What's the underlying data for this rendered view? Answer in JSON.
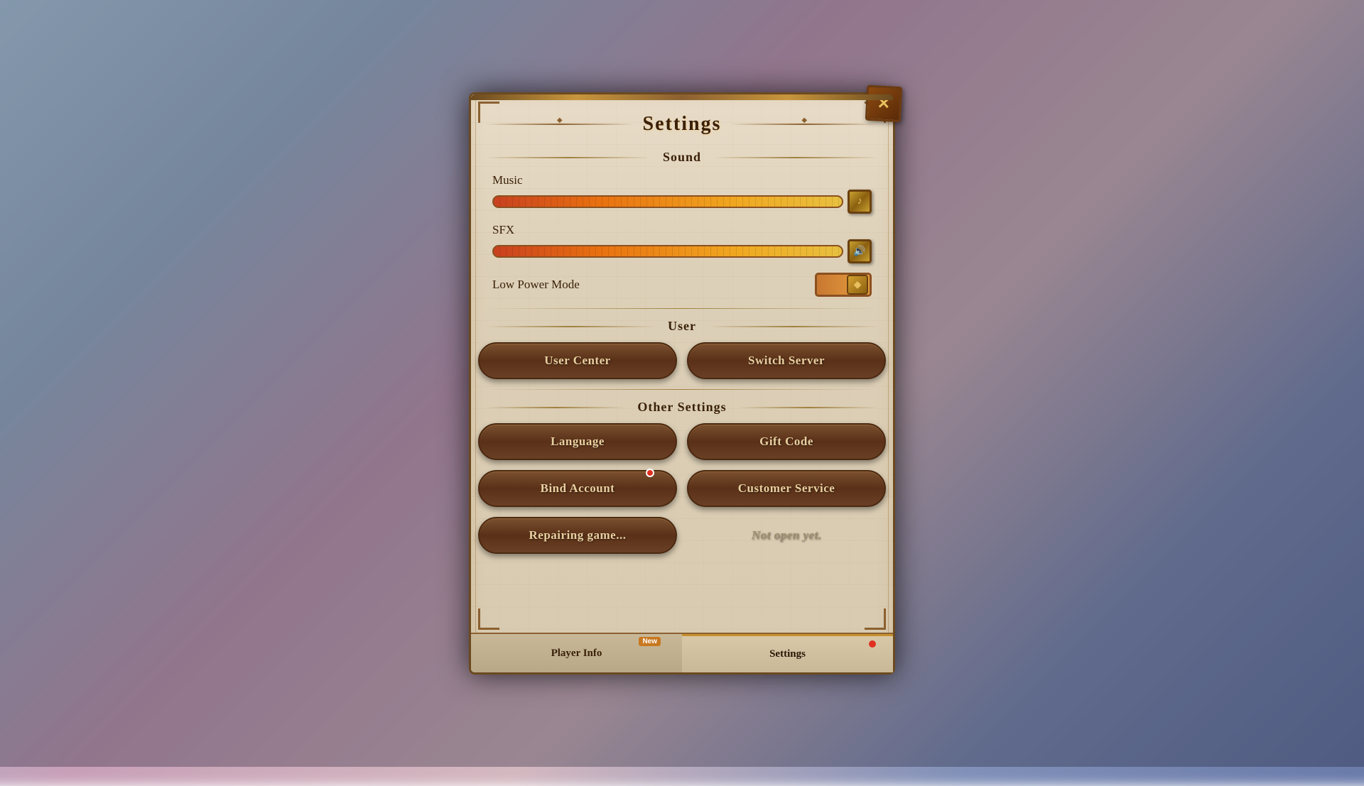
{
  "dialog": {
    "title": "Settings",
    "close_label": "✕"
  },
  "sound_section": {
    "label": "Sound",
    "music": {
      "label": "Music",
      "value": 95,
      "icon": "♪"
    },
    "sfx": {
      "label": "SFX",
      "value": 90,
      "icon": "🔊"
    }
  },
  "low_power": {
    "label": "Low Power Mode",
    "icon": "◆"
  },
  "user_section": {
    "label": "User"
  },
  "other_section": {
    "label": "Other Settings"
  },
  "buttons": {
    "user_center": "User Center",
    "switch_server": "Switch Server",
    "language": "Language",
    "gift_code": "Gift Code",
    "bind_account": "Bind Account",
    "customer_service": "Customer Service",
    "repairing_game": "Repairing game...",
    "not_open": "Not open yet."
  },
  "tabs": {
    "player_info": "Player Info",
    "settings": "Settings",
    "new_badge": "New"
  }
}
